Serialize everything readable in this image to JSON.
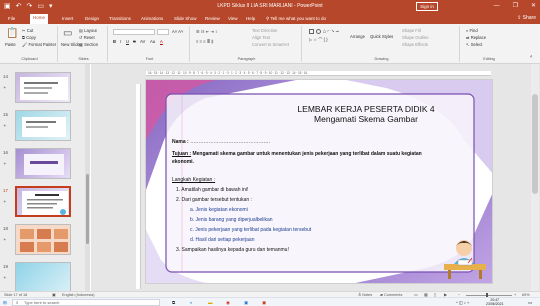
{
  "window": {
    "title": "LKPD Siklus II LIA SRI MARLIANI - PowerPoint",
    "sign_in": "Sign in",
    "controls": [
      "—",
      "❐",
      "✕"
    ]
  },
  "ribbon_tabs": [
    "File",
    "Home",
    "Insert",
    "Design",
    "Transitions",
    "Animations",
    "Slide Show",
    "Review",
    "View",
    "Help",
    "Tell me what you want to do"
  ],
  "share_label": "Share",
  "ribbon": {
    "clipboard": {
      "paste": "Paste",
      "cut": "Cut",
      "copy": "Copy",
      "format_painter": "Format Painter",
      "label": "Clipboard"
    },
    "slides": {
      "new_slide": "New Slide",
      "layout": "Layout",
      "reset": "Reset",
      "section": "Section",
      "label": "Slides"
    },
    "font": {
      "bold": "B",
      "italic": "I",
      "underline": "U",
      "strike": "S",
      "spacing": "AV",
      "case": "Aa",
      "color": "A",
      "label": "Font"
    },
    "paragraph": {
      "text_direction": "Text Direction",
      "align_text": "Align Text",
      "smartart": "Convert to SmartArt",
      "label": "Paragraph"
    },
    "drawing": {
      "arrange": "Arrange",
      "quick_styles": "Quick Styles",
      "shape_fill": "Shape Fill",
      "shape_outline": "Shape Outline",
      "shape_effects": "Shape Effects",
      "label": "Drawing"
    },
    "editing": {
      "find": "Find",
      "replace": "Replace",
      "select": "Select",
      "label": "Editing"
    }
  },
  "slide_numbers": [
    "14",
    "15",
    "16",
    "17",
    "18",
    "19"
  ],
  "slide": {
    "title": "LEMBAR KERJA PESERTA DIDIK 4",
    "subtitle": "Mengamati Skema Gambar",
    "nama_label": "Nama :",
    "nama_dots": "…………………………………………",
    "tujuan_label": "Tujuan :",
    "tujuan_text_1": "Mengamati skema gambar untuk menentukan jenis pekerjaan yang terlibat dalam suatu kegiatan",
    "tujuan_text_2": "ekonomi.",
    "langkah_title": "Langkah Kegiatan :",
    "steps": [
      "1.  Amatilah gambar di bawah ini!",
      "2.  Dari gambar tersebut tentukan :",
      "3.  Sampaikan hasilnya kepada guru dan temanmu!"
    ],
    "substeps": [
      "a.  Jenis kegiatan ekonomi",
      "b.  Jenis barang yang diperjualbelikan",
      "c.  Jenis pekerjaan yang terlibat pada kegiatan tersebut",
      "d.  Hasil dari setiap pekerjaan"
    ]
  },
  "ruler_numbers": "16 · 15 · 14 · 13 · 12 · 11 · 10 · 9 · 8 · 7 · 6 · 5 · 4 · 3 · 2 · 1 · 0 · 1 · 2 · 3 · 4 · 5 · 6 · 7 · 8 · 9 · 10 · 11 · 12 · 13 · 14 · 15 · 16",
  "statusbar": {
    "slide_of": "Slide 17 of 18",
    "language": "English (Indonesia)",
    "notes": "Notes",
    "comments": "Comments",
    "zoom": "69%"
  },
  "taskbar": {
    "search_placeholder": "Type here to search",
    "time": "20:47",
    "date": "23/06/2021"
  },
  "colors": {
    "accent": "#b7472a",
    "slide_frame": "#7a4fb0",
    "slide_pink": "#e0569e"
  }
}
